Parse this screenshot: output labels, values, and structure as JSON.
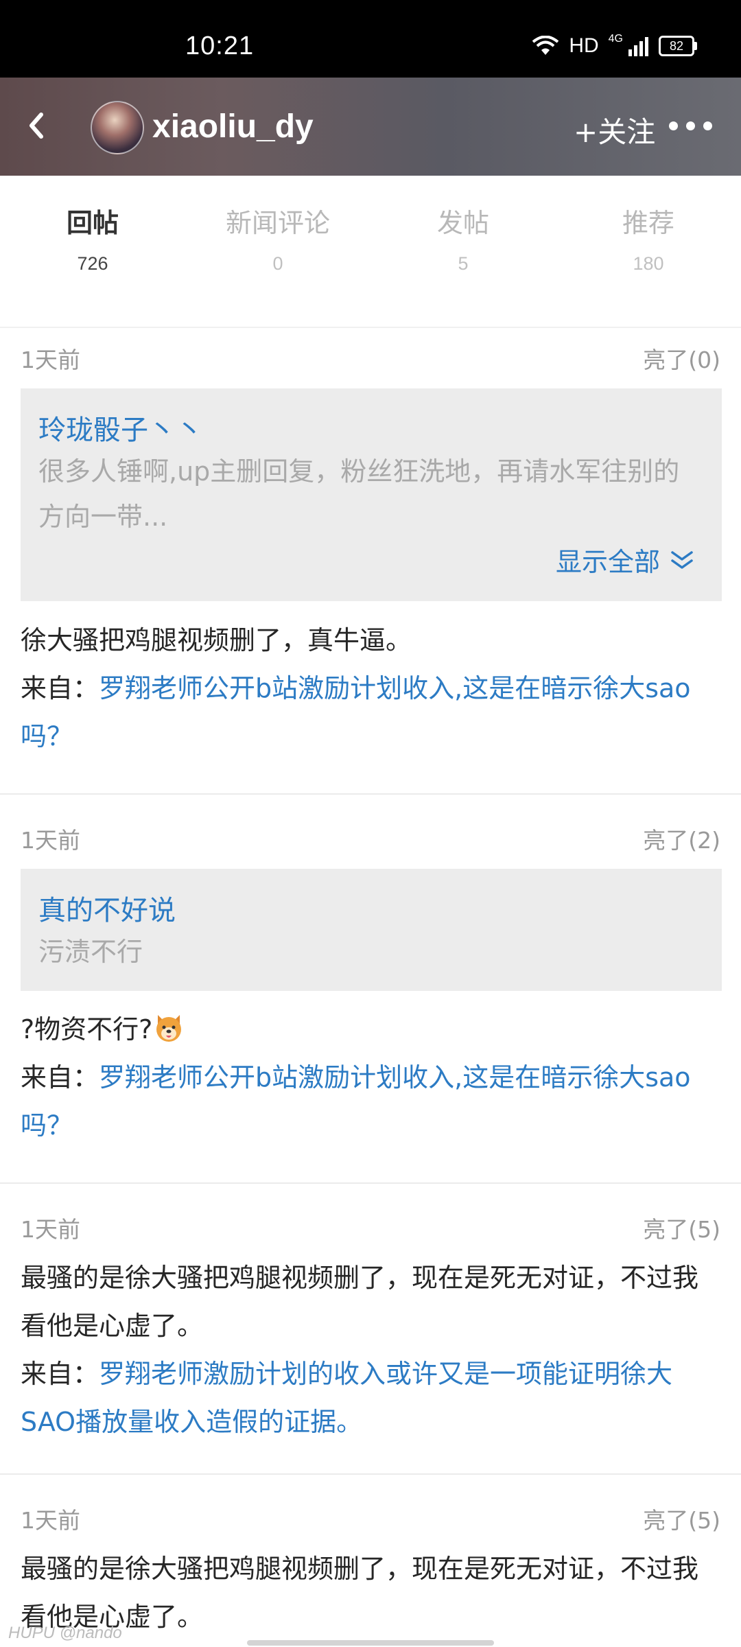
{
  "status": {
    "time": "10:21",
    "hd": "HD",
    "network": "4G",
    "battery": "82"
  },
  "header": {
    "username": "xiaoliu_dy",
    "follow_label": "+关注"
  },
  "tabs": [
    {
      "label": "回帖",
      "count": "726"
    },
    {
      "label": "新闻评论",
      "count": "0"
    },
    {
      "label": "发帖",
      "count": "5"
    },
    {
      "label": "推荐",
      "count": "180"
    }
  ],
  "posts": [
    {
      "time": "1天前",
      "likes": "亮了(0)",
      "quote_name": "玲珑骰子丶丶",
      "quote_text": "很多人锤啊,up主删回复，粉丝狂洗地，再请水军往别的方向一带...",
      "show_all": "显示全部",
      "body": "徐大骚把鸡腿视频删了，真牛逼。",
      "from_label": "来自：",
      "from_link": "罗翔老师公开b站激励计划收入,这是在暗示徐大sao吗？"
    },
    {
      "time": "1天前",
      "likes": "亮了(2)",
      "quote_name": "真的不好说",
      "quote_text": "污渍不行",
      "body": "?物资不行?",
      "from_label": "来自：",
      "from_link": "罗翔老师公开b站激励计划收入,这是在暗示徐大sao吗？"
    },
    {
      "time": "1天前",
      "likes": "亮了(5)",
      "body": "最骚的是徐大骚把鸡腿视频删了，现在是死无对证，不过我看他是心虚了。",
      "from_label": "来自：",
      "from_link": "罗翔老师激励计划的收入或许又是一项能证明徐大SAO播放量收入造假的证据。"
    },
    {
      "time": "1天前",
      "likes": "亮了(5)",
      "body": "最骚的是徐大骚把鸡腿视频删了，现在是死无对证，不过我看他是心虚了。"
    }
  ],
  "watermark": "HUPU @nando"
}
